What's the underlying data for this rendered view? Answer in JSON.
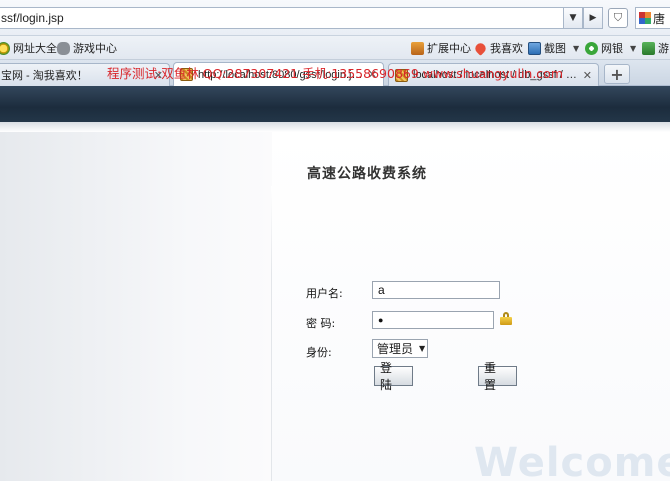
{
  "browser": {
    "address": "ssf/login.jsp",
    "user_label": "唐",
    "bookmarks": [
      {
        "label": "网址大全",
        "icon": "globe-icon"
      },
      {
        "label": "游戏中心",
        "icon": "gamepad-icon"
      },
      {
        "label": "扩展中心",
        "icon": "extension-icon"
      },
      {
        "label": "我喜欢",
        "icon": "heart-icon"
      },
      {
        "label": "截图",
        "icon": "screenshot-icon"
      },
      {
        "label": "网银",
        "icon": "bank-icon"
      },
      {
        "label": "游",
        "icon": "game-icon"
      }
    ],
    "tabs": [
      {
        "label": "宝网 - 淘我喜欢！"
      },
      {
        "label": "http://localhost:8080/gssf/login.jsp"
      },
      {
        "label": "localhost / localhost / db_gssf / t_..."
      }
    ]
  },
  "page": {
    "credit": "程序测试:双鱼林 QQ:287307421 手机:13558690869 www.shuangyulin.com",
    "title": "高速公路收费系统",
    "username_label": "用户名:",
    "username_value": "a",
    "password_label": "密 码:",
    "password_value": "●",
    "role_label": "身份:",
    "role_selected": "管理员",
    "login_button": "登陆",
    "reset_button": "重置",
    "welcome": "Welcome"
  },
  "colors": {
    "credit_red": "#d9262b",
    "banner_navy": "#1c2c3d"
  }
}
